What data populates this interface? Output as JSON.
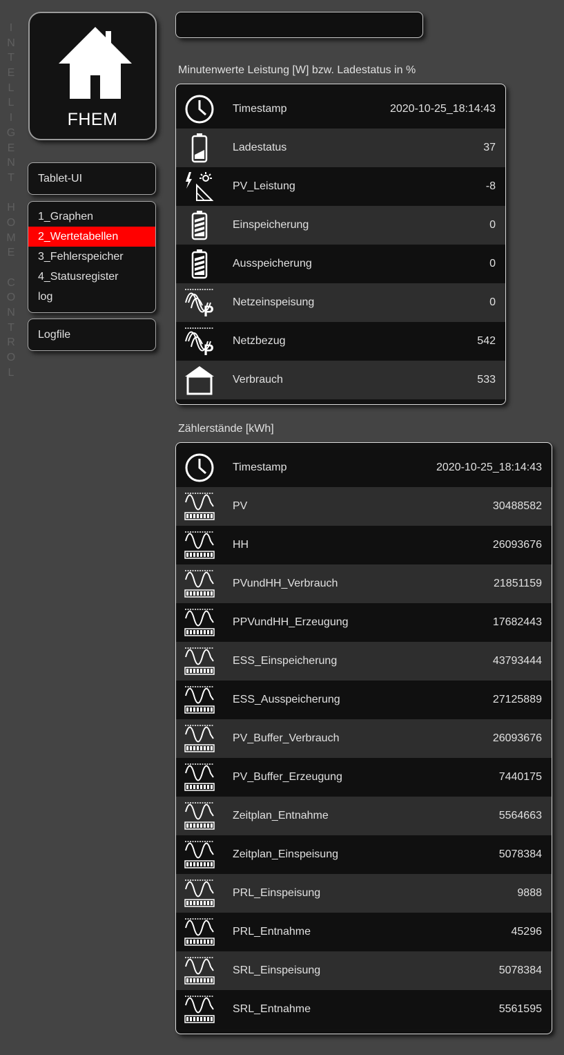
{
  "side_text": "INTELLIGENT HOME CONTROL",
  "logo": {
    "text": "FHEM"
  },
  "nav": {
    "tablet_ui": "Tablet-UI",
    "rooms": [
      {
        "label": "1_Graphen",
        "active": false
      },
      {
        "label": "2_Wertetabellen",
        "active": true
      },
      {
        "label": "3_Fehlerspeicher",
        "active": false
      },
      {
        "label": "4_Statusregister",
        "active": false
      },
      {
        "label": "log",
        "active": false
      }
    ],
    "logfile": "Logfile"
  },
  "search": {
    "value": ""
  },
  "section1": {
    "title": "Minutenwerte Leistung [W] bzw. Ladestatus in %",
    "rows": [
      {
        "icon": "clock-icon",
        "label": "Timestamp",
        "value": "2020-10-25_18:14:43"
      },
      {
        "icon": "battery-low-icon",
        "label": "Ladestatus",
        "value": "37"
      },
      {
        "icon": "solar-panel-icon",
        "label": "PV_Leistung",
        "value": "-8"
      },
      {
        "icon": "battery-full-icon",
        "label": "Einspeicherung",
        "value": "0"
      },
      {
        "icon": "battery-full-icon",
        "label": "Ausspeicherung",
        "value": "0"
      },
      {
        "icon": "grid-power-icon",
        "label": "Netzeinspeisung",
        "value": "0"
      },
      {
        "icon": "grid-power-icon",
        "label": "Netzbezug",
        "value": "542"
      },
      {
        "icon": "house-icon",
        "label": "Verbrauch",
        "value": "533"
      }
    ]
  },
  "section2": {
    "title": "Zählerstände [kWh]",
    "rows": [
      {
        "icon": "clock-icon",
        "label": "Timestamp",
        "value": "2020-10-25_18:14:43"
      },
      {
        "icon": "energy-meter-icon",
        "label": "PV",
        "value": "30488582"
      },
      {
        "icon": "energy-meter-icon",
        "label": "HH",
        "value": "26093676"
      },
      {
        "icon": "energy-meter-icon",
        "label": "PVundHH_Verbrauch",
        "value": "21851159"
      },
      {
        "icon": "energy-meter-icon",
        "label": "PPVundHH_Erzeugung",
        "value": "17682443"
      },
      {
        "icon": "energy-meter-icon",
        "label": "ESS_Einspeicherung",
        "value": "43793444"
      },
      {
        "icon": "energy-meter-icon",
        "label": "ESS_Ausspeicherung",
        "value": "27125889"
      },
      {
        "icon": "energy-meter-icon",
        "label": "PV_Buffer_Verbrauch",
        "value": "26093676"
      },
      {
        "icon": "energy-meter-icon",
        "label": "PV_Buffer_Erzeugung",
        "value": "7440175"
      },
      {
        "icon": "energy-meter-icon",
        "label": "Zeitplan_Entnahme",
        "value": "5564663"
      },
      {
        "icon": "energy-meter-icon",
        "label": "Zeitplan_Einspeisung",
        "value": "5078384"
      },
      {
        "icon": "energy-meter-icon",
        "label": "PRL_Einspeisung",
        "value": "9888"
      },
      {
        "icon": "energy-meter-icon",
        "label": "PRL_Entnahme",
        "value": "45296"
      },
      {
        "icon": "energy-meter-icon",
        "label": "SRL_Einspeisung",
        "value": "5078384"
      },
      {
        "icon": "energy-meter-icon",
        "label": "SRL_Entnahme",
        "value": "5561595"
      }
    ]
  }
}
